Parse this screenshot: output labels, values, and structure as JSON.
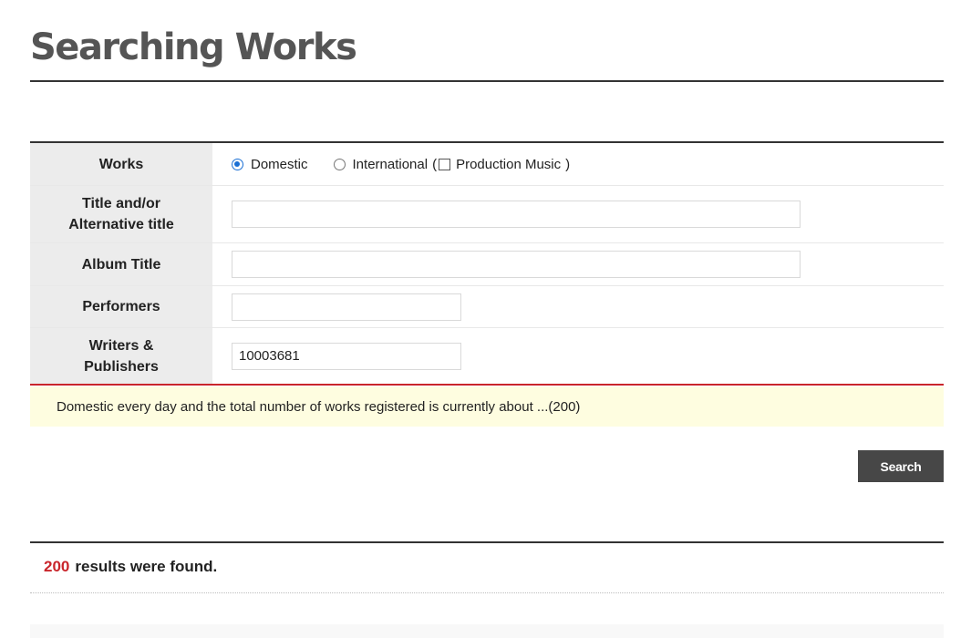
{
  "page": {
    "title": "Searching Works"
  },
  "form": {
    "works": {
      "label": "Works",
      "options": {
        "domestic": {
          "label": "Domestic",
          "selected": true
        },
        "international": {
          "label": "International",
          "selected": false,
          "open_paren": "(",
          "close_paren": ")"
        },
        "production_music": {
          "label": "Production Music",
          "checked": false
        }
      }
    },
    "title": {
      "label_line1": "Title and/or",
      "label_line2": "Alternative title",
      "value": ""
    },
    "album": {
      "label": "Album Title",
      "value": ""
    },
    "performers": {
      "label": "Performers",
      "value": ""
    },
    "writers": {
      "label_line1": "Writers &",
      "label_line2": "Publishers",
      "value": "10003681"
    }
  },
  "notice": {
    "text": "Domestic every day and the total number of works registered is currently about ...(200)"
  },
  "search_button": {
    "label": "Search"
  },
  "results": {
    "count": "200",
    "text": "results were found."
  },
  "colors": {
    "accent_red": "#c9252b",
    "radio_blue": "#1a6fd4",
    "button_dark": "#474747",
    "notice_bg": "#fefde0"
  }
}
